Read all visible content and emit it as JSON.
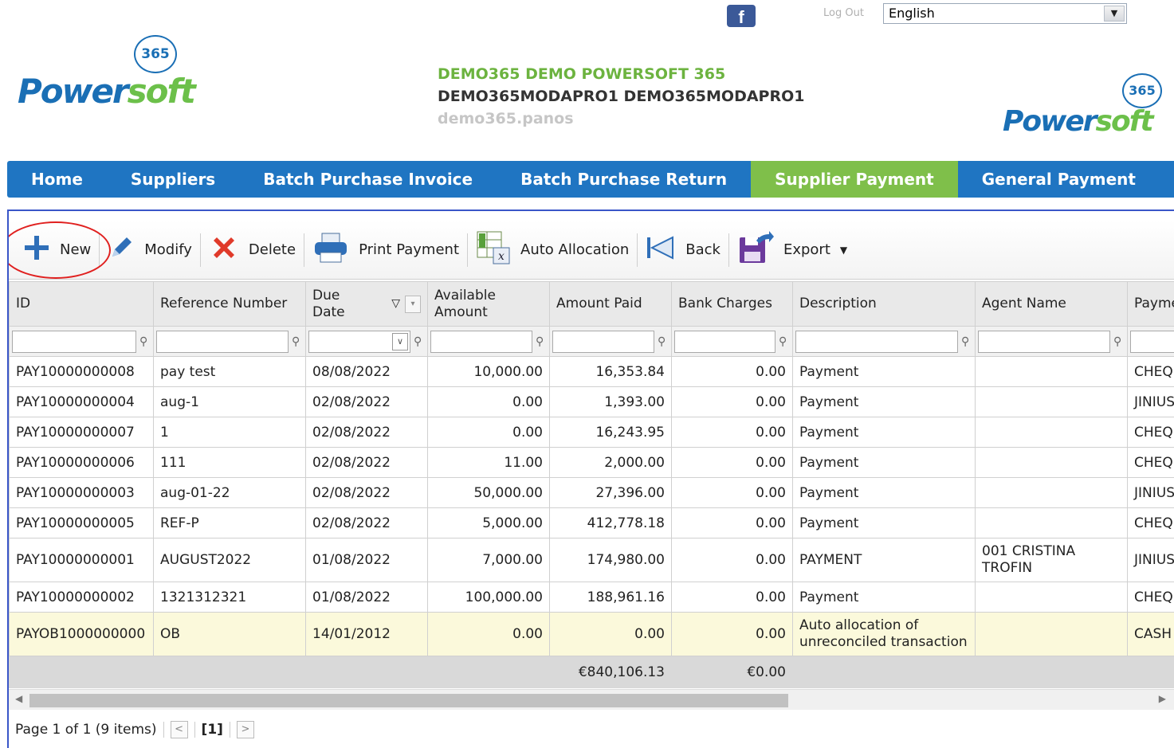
{
  "header": {
    "logout_label": "Log Out",
    "language": "English",
    "brand_power": "Power",
    "brand_soft": "soft",
    "brand_badge": "365",
    "company_name": "DEMO365 DEMO POWERSOFT 365",
    "company_code": "DEMO365MODAPRO1 DEMO365MODAPRO1",
    "username": "demo365.panos"
  },
  "nav": {
    "items": [
      {
        "label": "Home"
      },
      {
        "label": "Suppliers"
      },
      {
        "label": "Batch Purchase Invoice"
      },
      {
        "label": "Batch Purchase Return"
      },
      {
        "label": "Supplier Payment"
      },
      {
        "label": "General Payment"
      }
    ]
  },
  "toolbar": {
    "new": "New",
    "modify": "Modify",
    "delete": "Delete",
    "print": "Print Payment",
    "auto": "Auto Allocation",
    "back": "Back",
    "export": "Export"
  },
  "grid": {
    "columns": {
      "id": "ID",
      "ref": "Reference Number",
      "due_l1": "Due",
      "due_l2": "Date",
      "avail_l1": "Available",
      "avail_l2": "Amount",
      "paid": "Amount Paid",
      "bank": "Bank Charges",
      "desc": "Description",
      "agent": "Agent Name",
      "pay": "Payme"
    },
    "rows": [
      {
        "id": "PAY10000000008",
        "ref": "pay test",
        "due": "08/08/2022",
        "avail": "10,000.00",
        "paid": "16,353.84",
        "bank": "0.00",
        "desc": "Payment",
        "agent": "",
        "pay": "CHEQU"
      },
      {
        "id": "PAY10000000004",
        "ref": "aug-1",
        "due": "02/08/2022",
        "avail": "0.00",
        "paid": "1,393.00",
        "bank": "0.00",
        "desc": "Payment",
        "agent": "",
        "pay": "JINIUS"
      },
      {
        "id": "PAY10000000007",
        "ref": "1",
        "due": "02/08/2022",
        "avail": "0.00",
        "paid": "16,243.95",
        "bank": "0.00",
        "desc": "Payment",
        "agent": "",
        "pay": "CHEQU"
      },
      {
        "id": "PAY10000000006",
        "ref": "111",
        "due": "02/08/2022",
        "avail": "11.00",
        "paid": "2,000.00",
        "bank": "0.00",
        "desc": "Payment",
        "agent": "",
        "pay": "CHEQU"
      },
      {
        "id": "PAY10000000003",
        "ref": "aug-01-22",
        "due": "02/08/2022",
        "avail": "50,000.00",
        "paid": "27,396.00",
        "bank": "0.00",
        "desc": "Payment",
        "agent": "",
        "pay": "JINIUS"
      },
      {
        "id": "PAY10000000005",
        "ref": "REF-P",
        "due": "02/08/2022",
        "avail": "5,000.00",
        "paid": "412,778.18",
        "bank": "0.00",
        "desc": "Payment",
        "agent": "",
        "pay": "CHEQU"
      },
      {
        "id": "PAY10000000001",
        "ref": "AUGUST2022",
        "due": "01/08/2022",
        "avail": "7,000.00",
        "paid": "174,980.00",
        "bank": "0.00",
        "desc": "PAYMENT",
        "agent": "001 CRISTINA TROFIN",
        "pay": "JINIUS"
      },
      {
        "id": "PAY10000000002",
        "ref": "1321312321",
        "due": "01/08/2022",
        "avail": "100,000.00",
        "paid": "188,961.16",
        "bank": "0.00",
        "desc": "Payment",
        "agent": "",
        "pay": "CHEQU"
      },
      {
        "id": "PAYOB1000000000",
        "ref": "OB",
        "due": "14/01/2012",
        "avail": "0.00",
        "paid": "0.00",
        "bank": "0.00",
        "desc": "Auto allocation of unreconciled transaction",
        "agent": "",
        "pay": "CASH"
      }
    ],
    "totals": {
      "paid": "€840,106.13",
      "bank": "€0.00"
    }
  },
  "pager": {
    "text": "Page 1 of 1 (9 items)",
    "current": "[1]"
  }
}
